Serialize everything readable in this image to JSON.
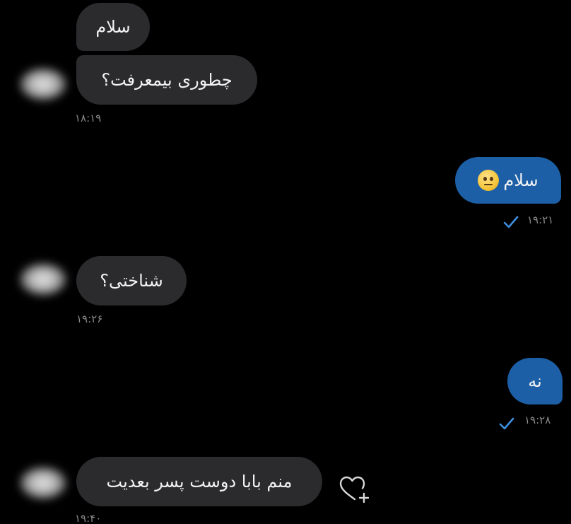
{
  "messages": [
    {
      "id": "m1",
      "direction": "incoming",
      "text": "سلام"
    },
    {
      "id": "m2",
      "direction": "incoming",
      "text": "چطوری بیمعرفت؟",
      "time": "۱۸:۱۹"
    },
    {
      "id": "m3",
      "direction": "outgoing",
      "text": "سلام",
      "emoji": "neutral-face-icon",
      "time": "۱۹:۲۱",
      "status": "sent"
    },
    {
      "id": "m4",
      "direction": "incoming",
      "text": "شناختی؟",
      "time": "۱۹:۲۶"
    },
    {
      "id": "m5",
      "direction": "outgoing",
      "text": "نه",
      "time": "۱۹:۲۸",
      "status": "sent"
    },
    {
      "id": "m6",
      "direction": "incoming",
      "text": "منم بابا دوست پسر بعدیت",
      "time": "۱۹:۴۰",
      "reaction_button": "heart-plus-icon"
    }
  ],
  "colors": {
    "background": "#000000",
    "incoming_bubble": "#2b2b2d",
    "outgoing_bubble": "#1d5fa6",
    "timestamp": "#8a8a8a",
    "checkmark": "#3d8fe0"
  }
}
